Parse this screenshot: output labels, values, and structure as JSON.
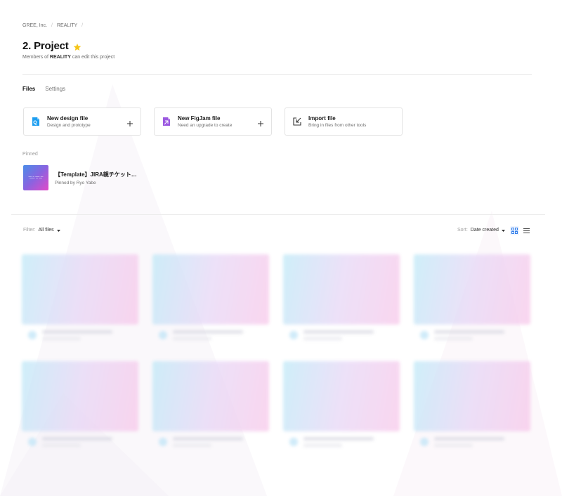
{
  "breadcrumb": [
    "GREE, Inc.",
    "REALITY"
  ],
  "page": {
    "title": "2. Project",
    "subtitle_prefix": "Members of",
    "subtitle_team": "REALITY",
    "subtitle_suffix": "can edit this project",
    "star_color": "#f5c518"
  },
  "tabs": [
    {
      "label": "Files",
      "active": true
    },
    {
      "label": "Settings",
      "active": false
    }
  ],
  "actions": [
    {
      "title": "New design file",
      "subtitle": "Design and prototype",
      "icon": "design-file-icon",
      "color": "#1e9ef0"
    },
    {
      "title": "New FigJam file",
      "subtitle": "Need an upgrade to create",
      "icon": "figjam-file-icon",
      "color": "#9b59e0"
    },
    {
      "title": "Import file",
      "subtitle": "Bring in files from other tools",
      "icon": "import-icon",
      "color": "#333333"
    }
  ],
  "pinned": {
    "label": "Pinned",
    "item": {
      "title": "【Template】JIRA親チケット…",
      "subtitle": "Pinned by Ryo Yabe"
    }
  },
  "filter": {
    "label": "Filter:",
    "value": "All files"
  },
  "sort": {
    "label": "Sort:",
    "value": "Date created"
  },
  "view_modes": [
    "grid-view-icon",
    "list-view-icon"
  ],
  "accent": "#1e73e8"
}
